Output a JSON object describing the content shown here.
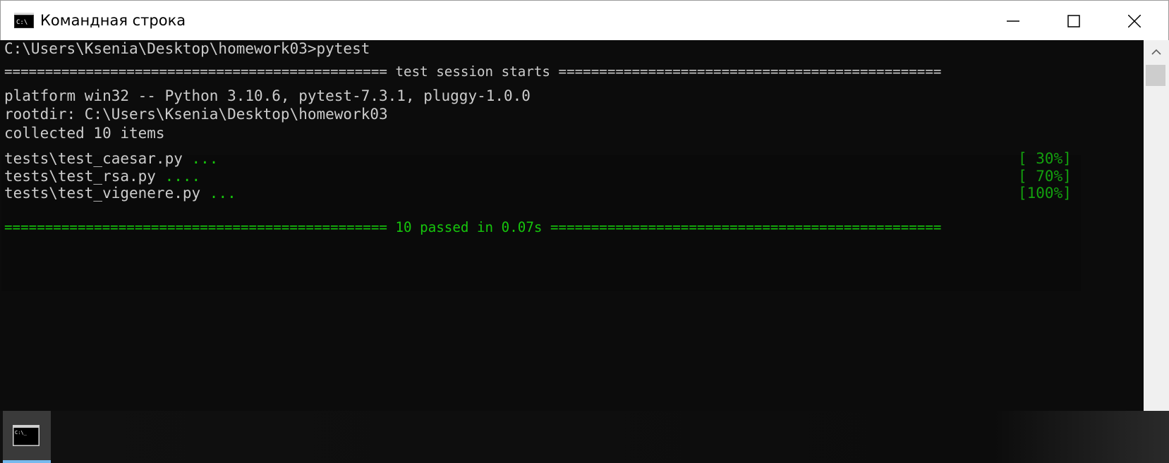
{
  "window": {
    "title": "Командная строка",
    "icon": "cmd-icon"
  },
  "controls": {
    "minimize_icon": "minimize-icon",
    "maximize_icon": "maximize-icon",
    "close_icon": "close-icon"
  },
  "console": {
    "prompt": "C:\\Users\\Ksenia\\Desktop\\homework03>pytest",
    "session_header": "=============================================== test session starts ===============================================",
    "platform": "platform win32 -- Python 3.10.6, pytest-7.3.1, pluggy-1.0.0",
    "rootdir": "rootdir: C:\\Users\\Ksenia\\Desktop\\homework03",
    "collected": "collected 10 items",
    "results": [
      {
        "file": "tests\\test_caesar.py ",
        "dots": "...",
        "percent": "[ 30%]"
      },
      {
        "file": "tests\\test_rsa.py ",
        "dots": "....",
        "percent": "[ 70%]"
      },
      {
        "file": "tests\\test_vigenere.py ",
        "dots": "...",
        "percent": "[100%]"
      }
    ],
    "summary": "=============================================== 10 passed in 0.07s ================================================"
  },
  "colors": {
    "background": "#0c0c0c",
    "text": "#cccccc",
    "green": "#16c60c"
  },
  "taskbar": {
    "app_icon": "terminal-icon"
  }
}
